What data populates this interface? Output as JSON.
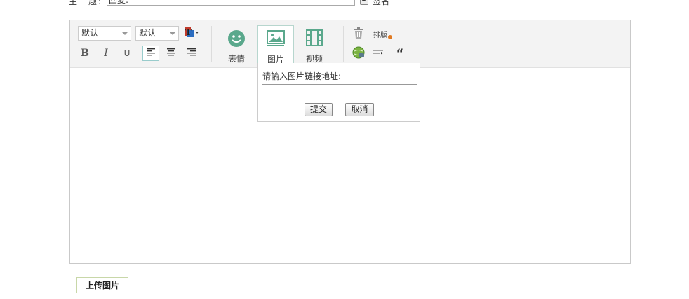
{
  "subject": {
    "label": "主　题:",
    "value": "回复:",
    "sign_label": "签名"
  },
  "toolbar": {
    "font_family": "默认",
    "font_size": "默认",
    "bold": "B",
    "italic": "I",
    "underline": "U",
    "emoji_label": "表情",
    "image_label": "图片",
    "video_label": "视频",
    "layout_label": "排版",
    "quote_glyph": "“"
  },
  "image_popup": {
    "title": "请输入图片链接地址:",
    "url_value": "",
    "submit_label": "提交",
    "cancel_label": "取消"
  },
  "upload_tab": {
    "label": "上传图片"
  },
  "colors": {
    "accent_green": "#5aa88c",
    "tab_border": "#c8d7a8"
  }
}
